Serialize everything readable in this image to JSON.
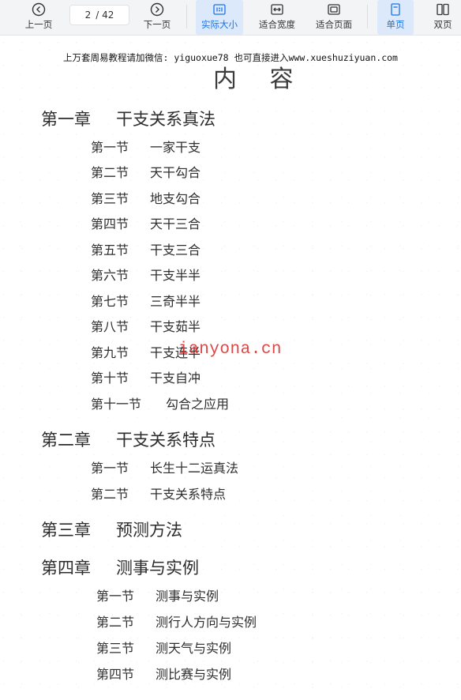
{
  "toolbar": {
    "prev": {
      "label": "上一页",
      "icon": "chevron-left-circle-icon"
    },
    "page_current": "2",
    "page_total": "/ 42",
    "next": {
      "label": "下一页",
      "icon": "chevron-right-circle-icon"
    },
    "actual_size": {
      "label": "实际大小",
      "icon": "one-to-one-icon"
    },
    "fit_width": {
      "label": "适合宽度",
      "icon": "fit-width-icon"
    },
    "fit_page": {
      "label": "适合页面",
      "icon": "fit-page-icon"
    },
    "single_page": {
      "label": "单页",
      "icon": "single-page-icon"
    },
    "double_page": {
      "label": "双页",
      "icon": "double-page-icon"
    },
    "accent_color": "#1a73e8"
  },
  "page": {
    "header_note": "上万套周易教程请加微信: yiguoxue78  也可直接进入www.xueshuziyuan.com",
    "title": "内 容",
    "watermark": "ianyona.cn",
    "watermark_color": "#d62828",
    "chapters": [
      {
        "num": "第一章",
        "name": "干支关系真法",
        "sections": [
          {
            "num": "第一节",
            "name": "一家干支"
          },
          {
            "num": "第二节",
            "name": "天干勾合"
          },
          {
            "num": "第三节",
            "name": "地支勾合"
          },
          {
            "num": "第四节",
            "name": "天干三合"
          },
          {
            "num": "第五节",
            "name": "干支三合"
          },
          {
            "num": "第六节",
            "name": "干支半半"
          },
          {
            "num": "第七节",
            "name": "三奇半半"
          },
          {
            "num": "第八节",
            "name": "干支茹半"
          },
          {
            "num": "第九节",
            "name": "干支连半"
          },
          {
            "num": "第十节",
            "name": "干支自冲"
          },
          {
            "num": "第十一节",
            "name": "勾合之应用"
          }
        ]
      },
      {
        "num": "第二章",
        "name": "干支关系特点",
        "sections": [
          {
            "num": "第一节",
            "name": "长生十二运真法"
          },
          {
            "num": "第二节",
            "name": "干支关系特点"
          }
        ]
      },
      {
        "num": "第三章",
        "name": "预测方法",
        "sections": []
      },
      {
        "num": "第四章",
        "name": "测事与实例",
        "sections": [
          {
            "num": "第一节",
            "name": "测事与实例"
          },
          {
            "num": "第二节",
            "name": "测行人方向与实例"
          },
          {
            "num": "第三节",
            "name": "测天气与实例"
          },
          {
            "num": "第四节",
            "name": "测比赛与实例"
          }
        ]
      }
    ]
  }
}
